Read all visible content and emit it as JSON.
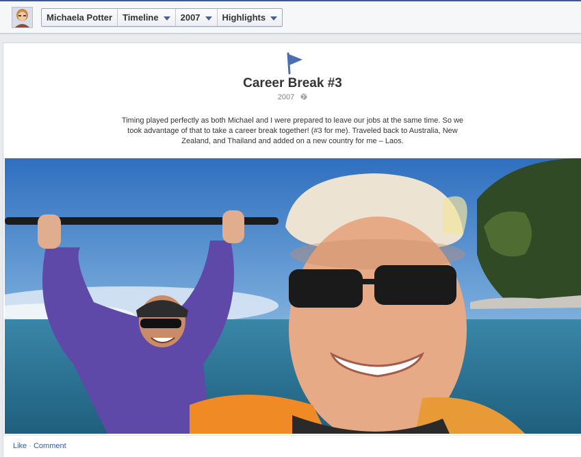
{
  "header": {
    "profile_name": "Michaela Potter",
    "breadcrumbs": [
      {
        "label": "Michaela Potter",
        "icon": null
      },
      {
        "label": "Timeline",
        "icon": "chevron-down-icon"
      },
      {
        "label": "2007",
        "icon": "chevron-down-icon"
      },
      {
        "label": "Highlights",
        "icon": "chevron-down-icon"
      }
    ]
  },
  "event": {
    "icon": "flag-icon",
    "title": "Career Break #3",
    "year": "2007",
    "privacy_icon": "globe-icon",
    "description": "Timing played perfectly as both Michael and I were prepared to leave our jobs at the same time. So we took advantage of that to take a career break together! (#3 for me). Traveled back to Australia, New Zealand, and Thailand and added on a new country for me – Laos."
  },
  "actions": {
    "like": "Like",
    "separator": "·",
    "comment": "Comment"
  },
  "colors": {
    "brand": "#3b5998",
    "flag": "#4a6eb5"
  }
}
